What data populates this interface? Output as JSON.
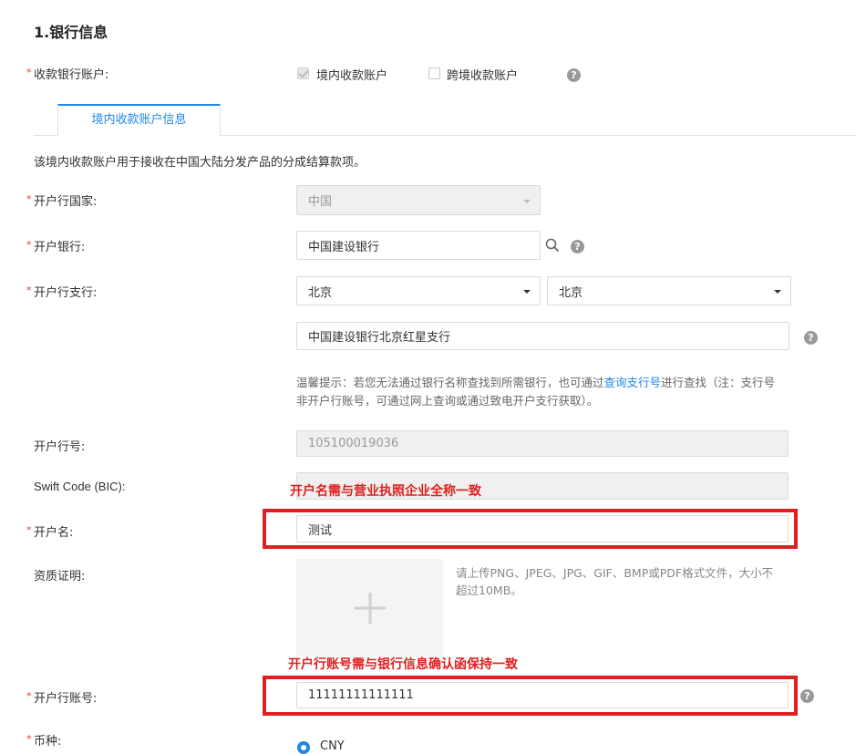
{
  "section": {
    "title": "1.银行信息"
  },
  "account_type": {
    "label": "收款银行账户:",
    "options": [
      {
        "label": "境内收款账户",
        "checked": true
      },
      {
        "label": "跨境收款账户",
        "checked": false
      }
    ]
  },
  "tabs": [
    {
      "label": "境内收款账户信息",
      "active": true
    }
  ],
  "description": "该境内收款账户用于接收在中国大陆分发产品的分成结算款项。",
  "fields": {
    "country": {
      "label": "开户行国家:",
      "value": "中国"
    },
    "bank": {
      "label": "开户银行:",
      "value": "中国建设银行"
    },
    "branch": {
      "label": "开户行支行:",
      "province": "北京",
      "city": "北京",
      "value": "中国建设银行北京红星支行"
    },
    "tip": {
      "prefix": "温馨提示：若您无法通过银行名称查找到所需银行，也可通过",
      "link": "查询支行号",
      "suffix": "进行查找（注：支行号",
      "line2": "非开户行账号，可通过网上查询或通过致电开户支行获取）。"
    },
    "bank_code": {
      "label": "开户行号:",
      "value": "105100019036"
    },
    "swift": {
      "label": "Swift Code (BIC):",
      "value": ""
    },
    "account_name": {
      "label": "开户名:",
      "value": "测试"
    },
    "qualification": {
      "label": "资质证明:",
      "hint_line1": "请上传PNG、JPEG、JPG、GIF、BMP或PDF格式文件，大小不",
      "hint_line2": "超过10MB。"
    },
    "account_no": {
      "label": "开户行账号:",
      "value": "11111111111111"
    },
    "currency": {
      "label": "币种:",
      "option": "CNY"
    }
  },
  "annotations": {
    "name_note": "开户名需与营业执照企业全称一致",
    "account_note": "开户行账号需与银行信息确认函保持一致",
    "color": "#e02020"
  },
  "icons": [
    "search-icon",
    "question-icon",
    "chevron-down-icon",
    "plus-icon"
  ],
  "accent": "#1e88e5"
}
